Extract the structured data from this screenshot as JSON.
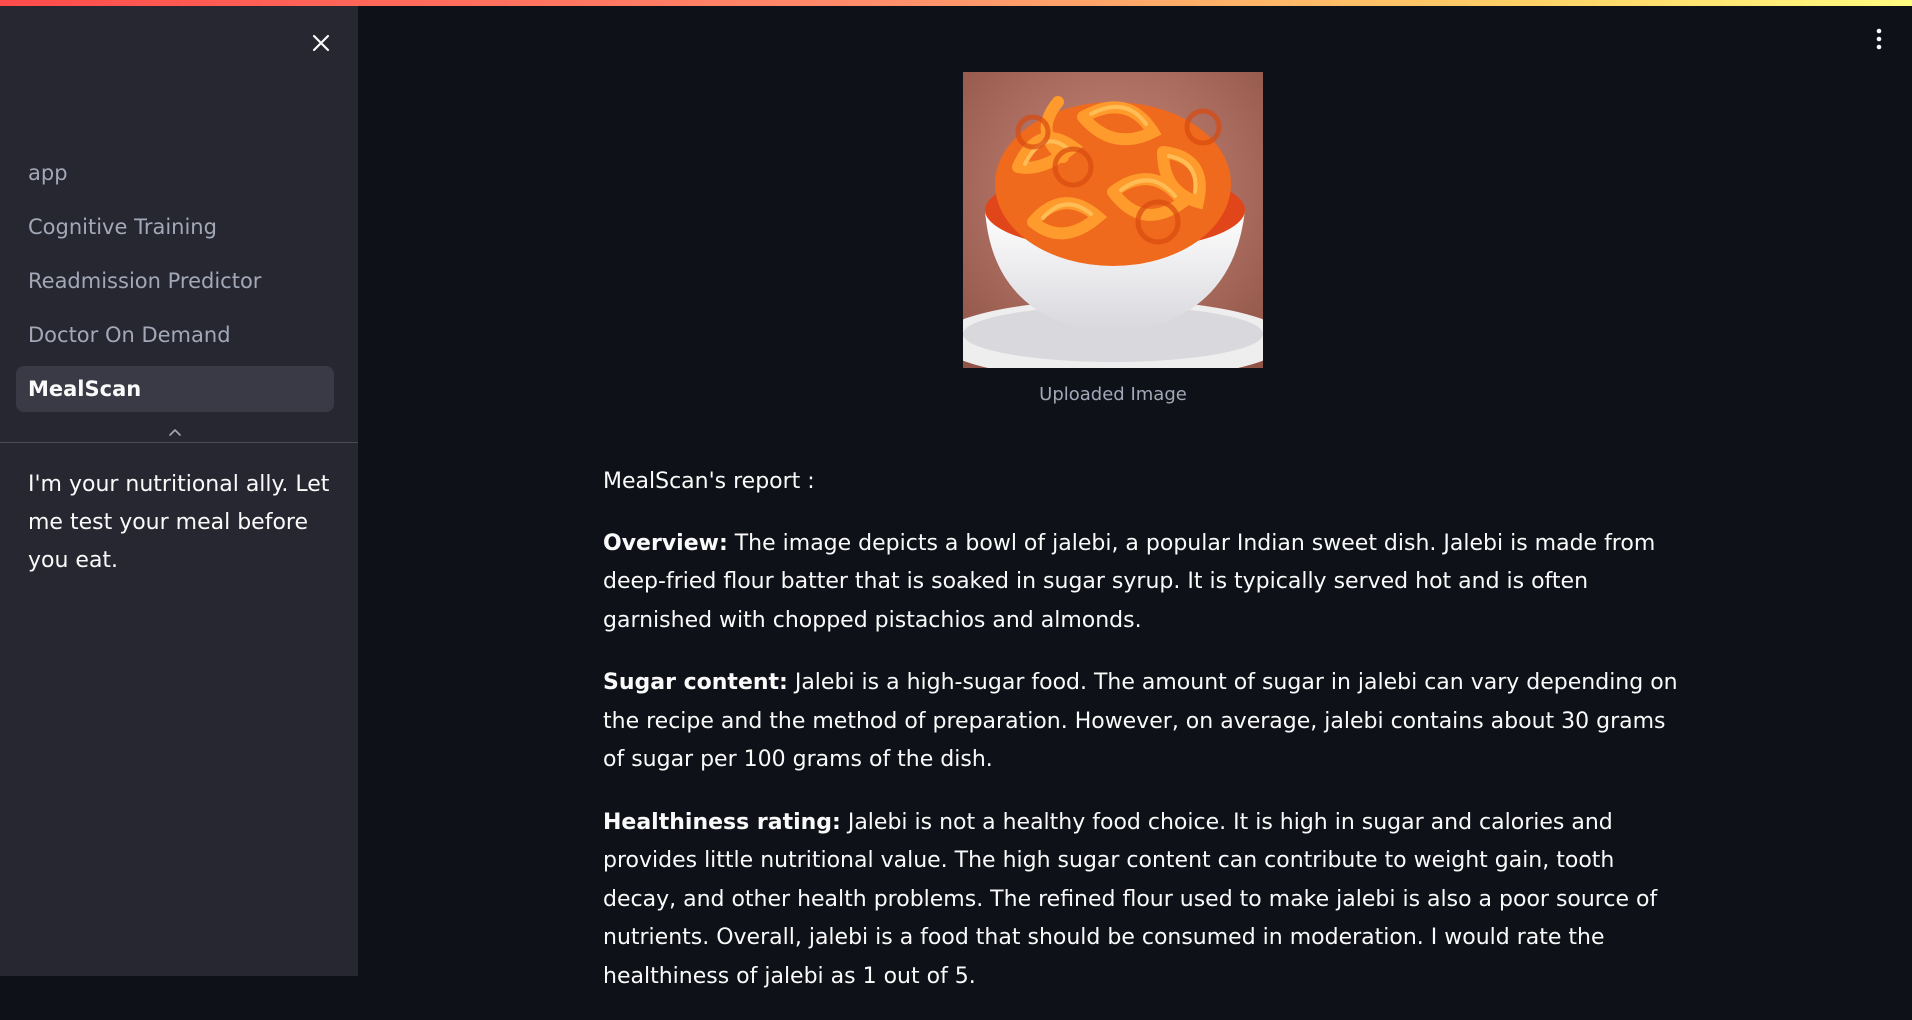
{
  "sidebar": {
    "nav_items": [
      {
        "label": "app",
        "active": false
      },
      {
        "label": "Cognitive Training",
        "active": false
      },
      {
        "label": "Readmission Predictor",
        "active": false
      },
      {
        "label": "Doctor On Demand",
        "active": false
      },
      {
        "label": "MealScan",
        "active": true
      }
    ],
    "description": "I'm your nutritional ally. Let me test your meal before you eat.",
    "icons": {
      "close": "close-icon",
      "collapse": "chevron-up-icon"
    }
  },
  "main": {
    "menu_icon": "kebab-menu-icon",
    "image": {
      "subject": "bowl of jalebi",
      "caption": "Uploaded Image"
    },
    "report": {
      "heading": "MealScan's report :",
      "sections": [
        {
          "label": "Overview:",
          "text": " The image depicts a bowl of jalebi, a popular Indian sweet dish. Jalebi is made from deep-fried flour batter that is soaked in sugar syrup. It is typically served hot and is often garnished with chopped pistachios and almonds."
        },
        {
          "label": "Sugar content:",
          "text": " Jalebi is a high-sugar food. The amount of sugar in jalebi can vary depending on the recipe and the method of preparation. However, on average, jalebi contains about 30 grams of sugar per 100 grams of the dish."
        },
        {
          "label": "Healthiness rating:",
          "text": " Jalebi is not a healthy food choice. It is high in sugar and calories and provides little nutritional value. The high sugar content can contribute to weight gain, tooth decay, and other health problems. The refined flour used to make jalebi is also a poor source of nutrients. Overall, jalebi is a food that should be consumed in moderation. I would rate the healthiness of jalebi as 1 out of 5."
        }
      ]
    }
  },
  "colors": {
    "background": "#0e1117",
    "sidebar": "#262730",
    "active_item": "#393a45",
    "text": "#fafafa",
    "muted_text": "#a3a8b8"
  }
}
